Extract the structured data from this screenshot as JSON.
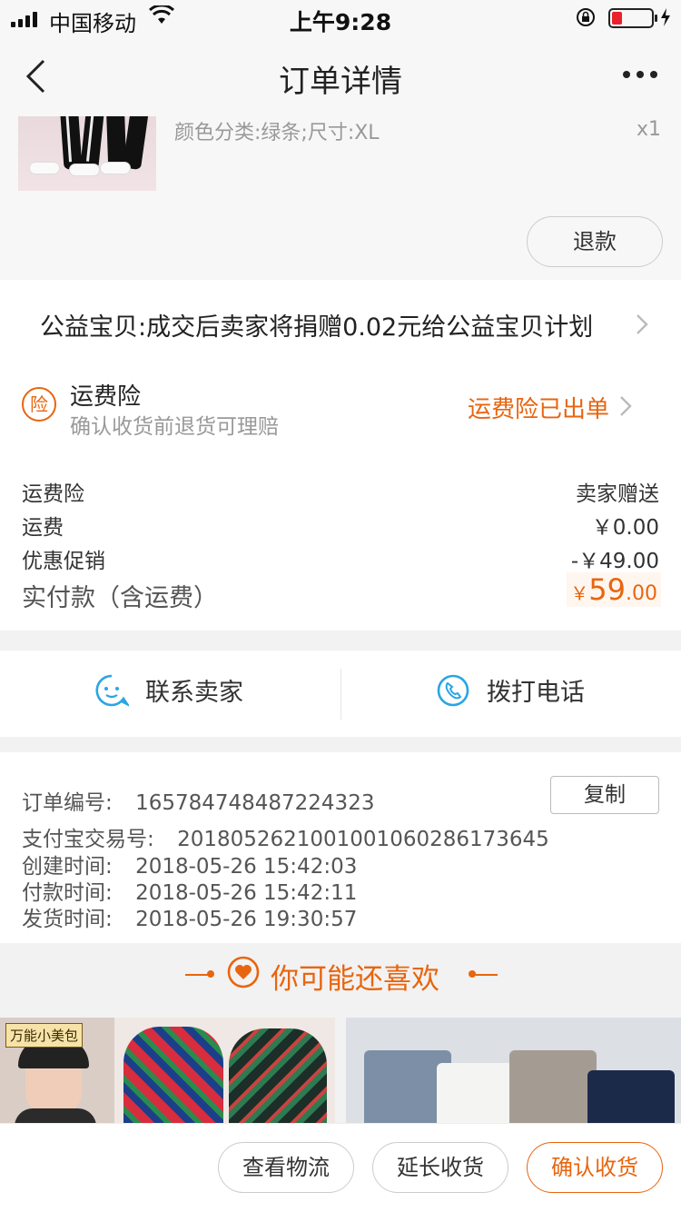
{
  "status_bar": {
    "carrier": "中国移动",
    "time": "上午9:28"
  },
  "nav": {
    "title": "订单详情"
  },
  "product": {
    "spec": "颜色分类:绿条;尺寸:XL",
    "quantity": "x1",
    "refund_label": "退款"
  },
  "charity": {
    "text": "公益宝贝:成交后卖家将捐赠0.02元给公益宝贝计划"
  },
  "insurance": {
    "icon_char": "险",
    "title": "运费险",
    "subtitle": "确认收货前退货可理赔",
    "status": "运费险已出单"
  },
  "fees": [
    {
      "label": "运费险",
      "value": "卖家赠送"
    },
    {
      "label": "运费",
      "value": "￥0.00"
    },
    {
      "label": "优惠促销",
      "value": "-￥49.00"
    }
  ],
  "total": {
    "label": "实付款（含运费）",
    "currency": "￥",
    "integer": "59",
    "decimal": ".00"
  },
  "contact": {
    "seller_label": "联系卖家",
    "phone_label": "拨打电话"
  },
  "order_info": {
    "order_no_label": "订单编号:",
    "order_no": "1657847484872243​23",
    "copy_label": "复制",
    "alipay_label": "支付宝交易号:",
    "alipay_no": "2018052621001001060286173645",
    "created_label": "创建时间:",
    "created": "2018-05-26 15:42:03",
    "paid_label": "付款时间:",
    "paid": "2018-05-26 15:42:11",
    "shipped_label": "发货时间:",
    "shipped": "2018-05-26 19:30:57"
  },
  "recommend": {
    "title": "你可能还喜欢",
    "card1_tag": "万能小美包"
  },
  "bottom": {
    "logistics_label": "查看物流",
    "extend_label": "延长收货",
    "confirm_label": "确认收货"
  },
  "colors": {
    "accent": "#e8650f"
  }
}
